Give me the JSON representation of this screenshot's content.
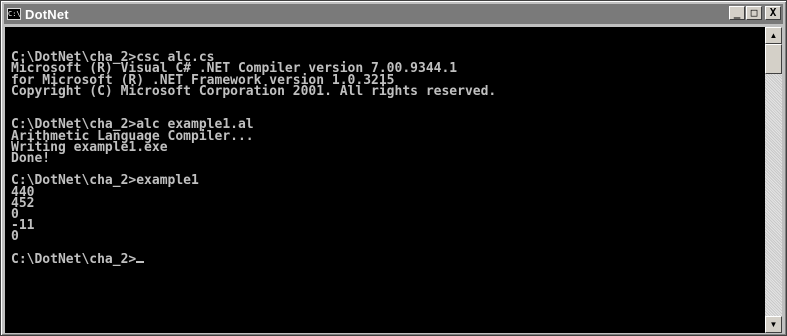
{
  "window": {
    "title": "DotNet",
    "icon": "console-icon",
    "icon_glyph": "C:\\",
    "buttons": {
      "minimize": "_",
      "maximize": "□",
      "close": "X"
    }
  },
  "console": {
    "lines": [
      "",
      "C:\\DotNet\\cha_2>csc alc.cs",
      "Microsoft (R) Visual C# .NET Compiler version 7.00.9344.1",
      "for Microsoft (R) .NET Framework version 1.0.3215",
      "Copyright (C) Microsoft Corporation 2001. All rights reserved.",
      "",
      "",
      "C:\\DotNet\\cha_2>alc example1.al",
      "Arithmetic Language Compiler...",
      "Writing example1.exe",
      "Done!",
      "",
      "C:\\DotNet\\cha_2>example1",
      "440",
      "452",
      "0",
      "-11",
      "0",
      "",
      "C:\\DotNet\\cha_2>"
    ]
  },
  "scrollbar": {
    "up_arrow": "▲",
    "down_arrow": "▼"
  }
}
